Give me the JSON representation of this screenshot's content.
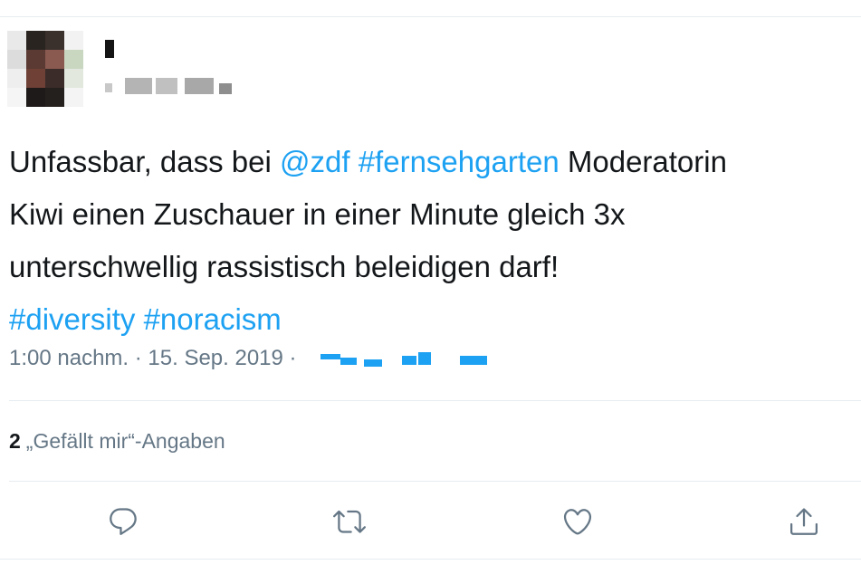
{
  "tweet": {
    "segments": [
      [
        {
          "text": "Unfassbar, dass bei ",
          "link": false
        },
        {
          "text": "@zdf",
          "link": true
        },
        {
          "text": " ",
          "link": false
        },
        {
          "text": "#fernsehgarten",
          "link": true
        },
        {
          "text": " Moderatorin",
          "link": false
        }
      ],
      [
        {
          "text": "Kiwi einen Zuschauer in einer Minute gleich 3x",
          "link": false
        }
      ],
      [
        {
          "text": "unterschwellig rassistisch beleidigen darf!",
          "link": false
        }
      ],
      [
        {
          "text": "#diversity",
          "link": true
        },
        {
          "text": " ",
          "link": false
        },
        {
          "text": "#noracism",
          "link": true
        }
      ]
    ],
    "timestamp": "1:00 nachm. · 15. Sep. 2019 ·",
    "likes_count": "2",
    "likes_label": "„Gefällt mir“-Angaben"
  },
  "actions": [
    {
      "name": "reply-icon"
    },
    {
      "name": "retweet-icon"
    },
    {
      "name": "like-icon"
    },
    {
      "name": "share-icon"
    }
  ],
  "colors": {
    "link": "#1da1f2",
    "text": "#14171a",
    "muted": "#657786",
    "divider": "#e6ecf0"
  }
}
